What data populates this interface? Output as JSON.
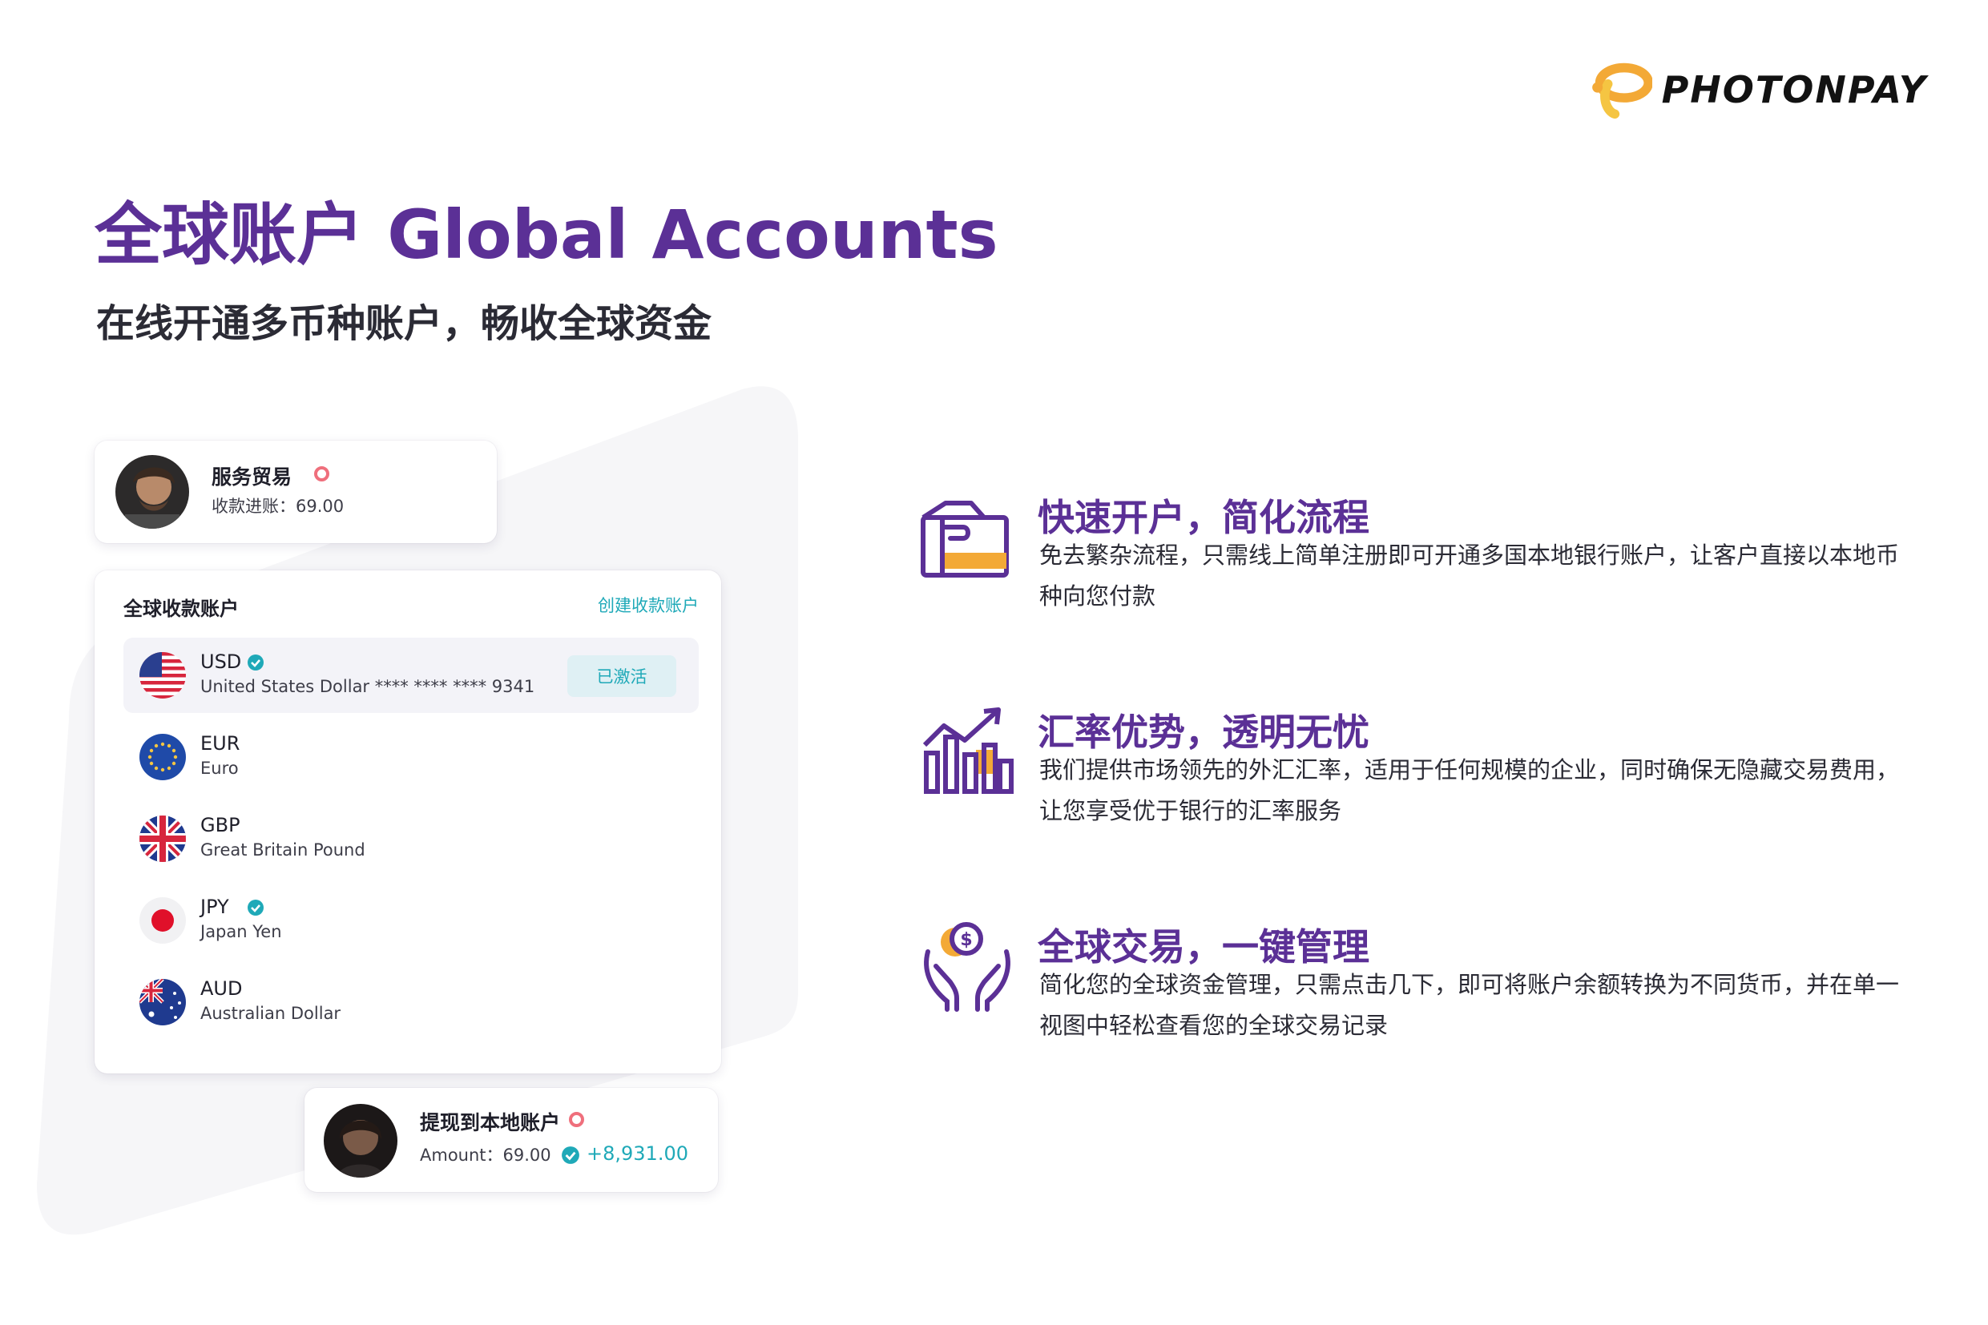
{
  "brand": {
    "name": "PHOTONPAY",
    "accent": "#5b3096",
    "logo_color": "#f3a936",
    "teal": "#1fa9b8",
    "alert": "#ef6f7c"
  },
  "header": {
    "title": "全球账户 Global Accounts",
    "subtitle": "在线开通多币种账户，畅收全球资金"
  },
  "notice_top": {
    "title": "服务贸易",
    "line": "收款进账：69.00",
    "avatar": "user-avatar"
  },
  "accounts": {
    "title": "全球收款账户",
    "create_link": "创建收款账户",
    "rows": [
      {
        "code": "USD",
        "name": "United States Dollar **** **** **** 9341",
        "verified": true,
        "status": "已激活",
        "flag": "us-flag-icon"
      },
      {
        "code": "EUR",
        "name": "Euro",
        "verified": false,
        "flag": "eu-flag-icon"
      },
      {
        "code": "GBP",
        "name": "Great Britain Pound",
        "verified": false,
        "flag": "uk-flag-icon"
      },
      {
        "code": "JPY",
        "name": "Japan Yen",
        "verified": true,
        "flag": "jp-flag-icon"
      },
      {
        "code": "AUD",
        "name": "Australian Dollar",
        "verified": false,
        "flag": "au-flag-icon"
      }
    ]
  },
  "notice_bottom": {
    "title": "提现到本地账户",
    "line": "Amount：69.00",
    "amount": "+8,931.00",
    "avatar": "user-avatar"
  },
  "features": [
    {
      "icon": "card-hand-icon",
      "title": "快速开户，简化流程",
      "desc": "免去繁杂流程，只需线上简单注册即可开通多国本地银行账户，让客户直接以本地币种向您付款"
    },
    {
      "icon": "rate-chart-icon",
      "title": "汇率优势，透明无忧",
      "desc": "我们提供市场领先的外汇汇率，适用于任何规模的企业，同时确保无隐藏交易费用，让您享受优于银行的汇率服务"
    },
    {
      "icon": "hands-coin-icon",
      "title": "全球交易，一键管理",
      "desc": "简化您的全球资金管理，只需点击几下，即可将账户余额转换为不同货币，并在单一视图中轻松查看您的全球交易记录"
    }
  ]
}
